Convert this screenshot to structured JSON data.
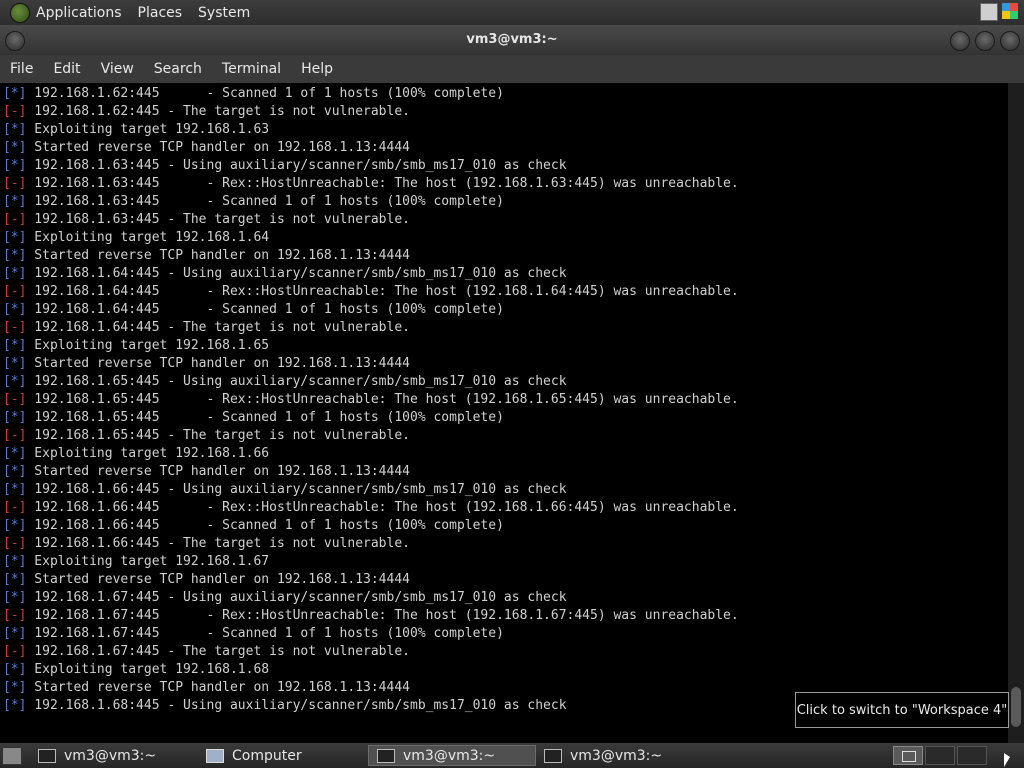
{
  "top_panel": {
    "menus": [
      "Applications",
      "Places",
      "System"
    ]
  },
  "window": {
    "title": "vm3@vm3:~",
    "menus": [
      "File",
      "Edit",
      "View",
      "Search",
      "Terminal",
      "Help"
    ]
  },
  "terminal": {
    "lines": [
      {
        "tag": "[*]",
        "type": "info",
        "text": " 192.168.1.62:445      - Scanned 1 of 1 hosts (100% complete)"
      },
      {
        "tag": "[-]",
        "type": "bad",
        "text": " 192.168.1.62:445 - The target is not vulnerable."
      },
      {
        "tag": "[*]",
        "type": "info",
        "text": " Exploiting target 192.168.1.63"
      },
      {
        "tag": "[*]",
        "type": "info",
        "text": " Started reverse TCP handler on 192.168.1.13:4444"
      },
      {
        "tag": "[*]",
        "type": "info",
        "text": " 192.168.1.63:445 - Using auxiliary/scanner/smb/smb_ms17_010 as check"
      },
      {
        "tag": "[-]",
        "type": "bad",
        "text": " 192.168.1.63:445      - Rex::HostUnreachable: The host (192.168.1.63:445) was unreachable."
      },
      {
        "tag": "[*]",
        "type": "info",
        "text": " 192.168.1.63:445      - Scanned 1 of 1 hosts (100% complete)"
      },
      {
        "tag": "[-]",
        "type": "bad",
        "text": " 192.168.1.63:445 - The target is not vulnerable."
      },
      {
        "tag": "[*]",
        "type": "info",
        "text": " Exploiting target 192.168.1.64"
      },
      {
        "tag": "[*]",
        "type": "info",
        "text": " Started reverse TCP handler on 192.168.1.13:4444"
      },
      {
        "tag": "[*]",
        "type": "info",
        "text": " 192.168.1.64:445 - Using auxiliary/scanner/smb/smb_ms17_010 as check"
      },
      {
        "tag": "[-]",
        "type": "bad",
        "text": " 192.168.1.64:445      - Rex::HostUnreachable: The host (192.168.1.64:445) was unreachable."
      },
      {
        "tag": "[*]",
        "type": "info",
        "text": " 192.168.1.64:445      - Scanned 1 of 1 hosts (100% complete)"
      },
      {
        "tag": "[-]",
        "type": "bad",
        "text": " 192.168.1.64:445 - The target is not vulnerable."
      },
      {
        "tag": "[*]",
        "type": "info",
        "text": " Exploiting target 192.168.1.65"
      },
      {
        "tag": "[*]",
        "type": "info",
        "text": " Started reverse TCP handler on 192.168.1.13:4444"
      },
      {
        "tag": "[*]",
        "type": "info",
        "text": " 192.168.1.65:445 - Using auxiliary/scanner/smb/smb_ms17_010 as check"
      },
      {
        "tag": "[-]",
        "type": "bad",
        "text": " 192.168.1.65:445      - Rex::HostUnreachable: The host (192.168.1.65:445) was unreachable."
      },
      {
        "tag": "[*]",
        "type": "info",
        "text": " 192.168.1.65:445      - Scanned 1 of 1 hosts (100% complete)"
      },
      {
        "tag": "[-]",
        "type": "bad",
        "text": " 192.168.1.65:445 - The target is not vulnerable."
      },
      {
        "tag": "[*]",
        "type": "info",
        "text": " Exploiting target 192.168.1.66"
      },
      {
        "tag": "[*]",
        "type": "info",
        "text": " Started reverse TCP handler on 192.168.1.13:4444"
      },
      {
        "tag": "[*]",
        "type": "info",
        "text": " 192.168.1.66:445 - Using auxiliary/scanner/smb/smb_ms17_010 as check"
      },
      {
        "tag": "[-]",
        "type": "bad",
        "text": " 192.168.1.66:445      - Rex::HostUnreachable: The host (192.168.1.66:445) was unreachable."
      },
      {
        "tag": "[*]",
        "type": "info",
        "text": " 192.168.1.66:445      - Scanned 1 of 1 hosts (100% complete)"
      },
      {
        "tag": "[-]",
        "type": "bad",
        "text": " 192.168.1.66:445 - The target is not vulnerable."
      },
      {
        "tag": "[*]",
        "type": "info",
        "text": " Exploiting target 192.168.1.67"
      },
      {
        "tag": "[*]",
        "type": "info",
        "text": " Started reverse TCP handler on 192.168.1.13:4444"
      },
      {
        "tag": "[*]",
        "type": "info",
        "text": " 192.168.1.67:445 - Using auxiliary/scanner/smb/smb_ms17_010 as check"
      },
      {
        "tag": "[-]",
        "type": "bad",
        "text": " 192.168.1.67:445      - Rex::HostUnreachable: The host (192.168.1.67:445) was unreachable."
      },
      {
        "tag": "[*]",
        "type": "info",
        "text": " 192.168.1.67:445      - Scanned 1 of 1 hosts (100% complete)"
      },
      {
        "tag": "[-]",
        "type": "bad",
        "text": " 192.168.1.67:445 - The target is not vulnerable."
      },
      {
        "tag": "[*]",
        "type": "info",
        "text": " Exploiting target 192.168.1.68"
      },
      {
        "tag": "[*]",
        "type": "info",
        "text": " Started reverse TCP handler on 192.168.1.13:4444"
      },
      {
        "tag": "[*]",
        "type": "info",
        "text": " 192.168.1.68:445 - Using auxiliary/scanner/smb/smb_ms17_010 as check"
      }
    ]
  },
  "tooltip": {
    "text": "Click to switch to \"Workspace 4\""
  },
  "taskbar": {
    "tasks": [
      {
        "label": "vm3@vm3:~",
        "icon": "terminal-icon",
        "active": false
      },
      {
        "label": "Computer",
        "icon": "computer-icon",
        "active": false
      },
      {
        "label": "vm3@vm3:~",
        "icon": "terminal-icon",
        "active": true
      },
      {
        "label": "vm3@vm3:~",
        "icon": "terminal-icon",
        "active": false
      }
    ]
  },
  "colors": {
    "info_tag": "#5a7bd6",
    "error_tag": "#d23a3a",
    "terminal_bg": "#000000",
    "terminal_fg": "#d0d0d0"
  }
}
